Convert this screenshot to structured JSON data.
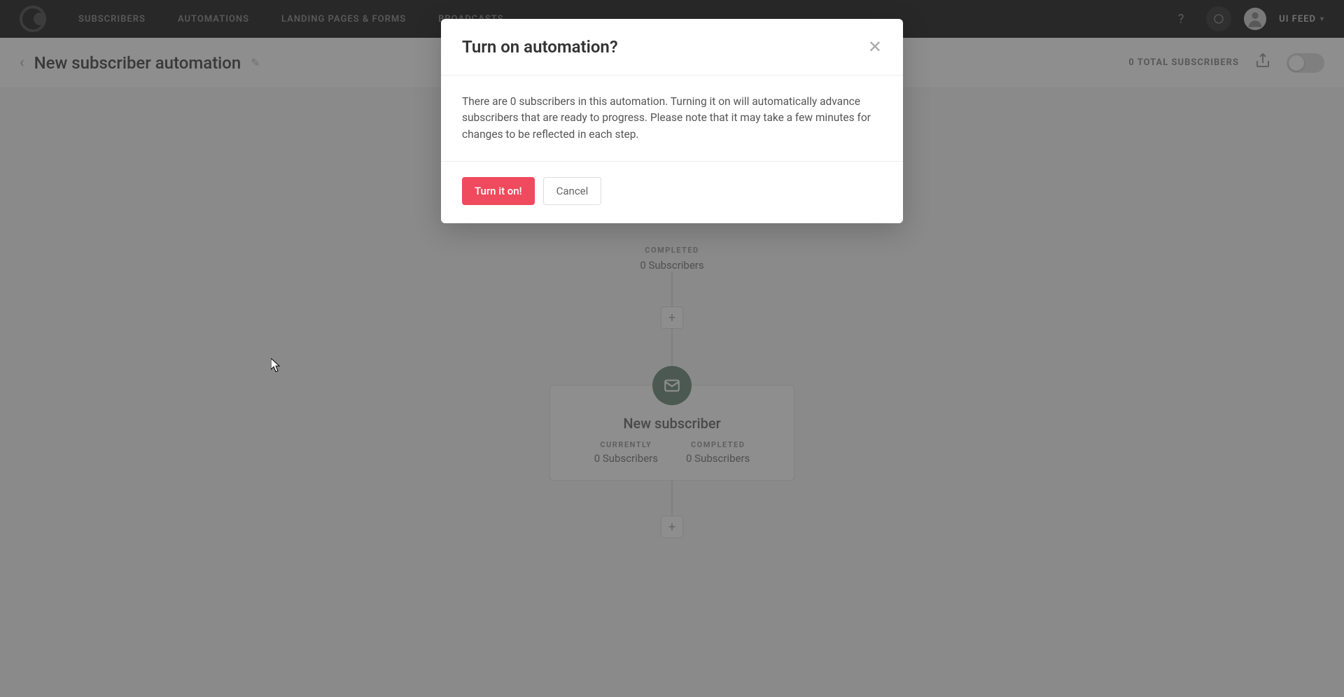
{
  "nav": {
    "subscribers": "SUBSCRIBERS",
    "automations": "AUTOMATIONS",
    "landing": "LANDING PAGES & FORMS",
    "broadcasts": "BROADCASTS",
    "help": "?",
    "user_label": "UI FEED"
  },
  "subheader": {
    "title": "New subscriber automation",
    "total": "0 TOTAL SUBSCRIBERS"
  },
  "top_step": {
    "completed_label": "COMPLETED",
    "completed_value": "0 Subscribers"
  },
  "email_step": {
    "title": "New subscriber",
    "currently_label": "CURRENTLY",
    "currently_value": "0 Subscribers",
    "completed_label": "COMPLETED",
    "completed_value": "0 Subscribers"
  },
  "add_button": "+",
  "modal": {
    "title": "Turn on automation?",
    "body": "There are 0 subscribers in this automation. Turning it on will automatically advance subscribers that are ready to progress. Please note that it may take a few minutes for changes to be reflected in each step.",
    "primary": "Turn it on!",
    "secondary": "Cancel"
  }
}
